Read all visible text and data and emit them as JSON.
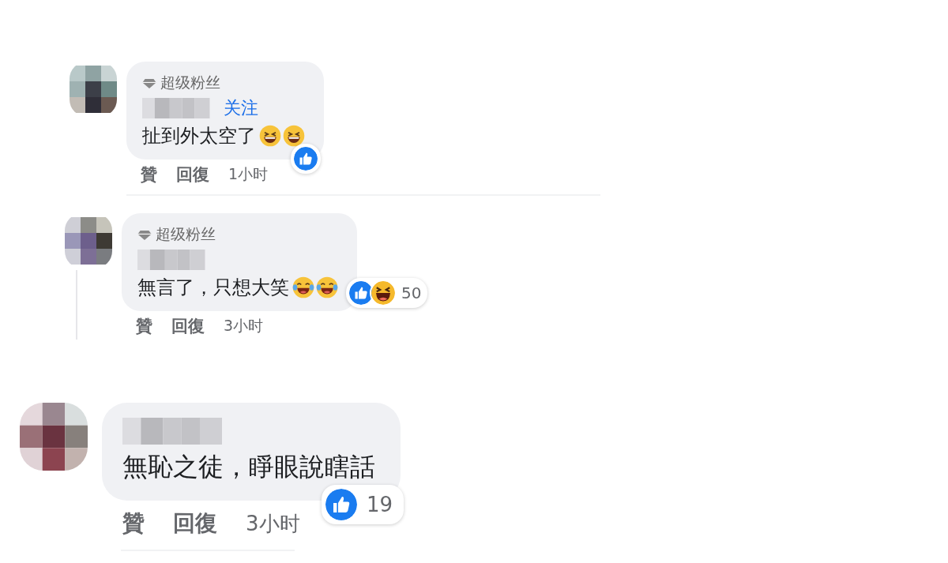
{
  "comments": [
    {
      "kind": "reply",
      "badge": "超级粉丝",
      "follow": "关注",
      "text": "扯到外太空了",
      "emojis": [
        {
          "kind": "grin"
        },
        {
          "kind": "grin"
        }
      ],
      "reactions": [
        {
          "kind": "like"
        }
      ],
      "actions": [
        "贊",
        "回復"
      ],
      "time": "1小时"
    },
    {
      "kind": "reply",
      "badge": "超级粉丝",
      "text": "無言了，只想大笑",
      "emojis": [
        {
          "kind": "joy"
        },
        {
          "kind": "joy"
        }
      ],
      "reactions": [
        {
          "kind": "like"
        },
        {
          "kind": "haha"
        }
      ],
      "count": "50",
      "actions": [
        "贊",
        "回復"
      ],
      "time": "3小时",
      "thread": true
    },
    {
      "kind": "comment",
      "text": "無恥之徒，睜眼說瞎話",
      "reactions": [
        {
          "kind": "like"
        }
      ],
      "count": "19",
      "actions": [
        "贊",
        "回復"
      ],
      "time": "3小时"
    }
  ]
}
